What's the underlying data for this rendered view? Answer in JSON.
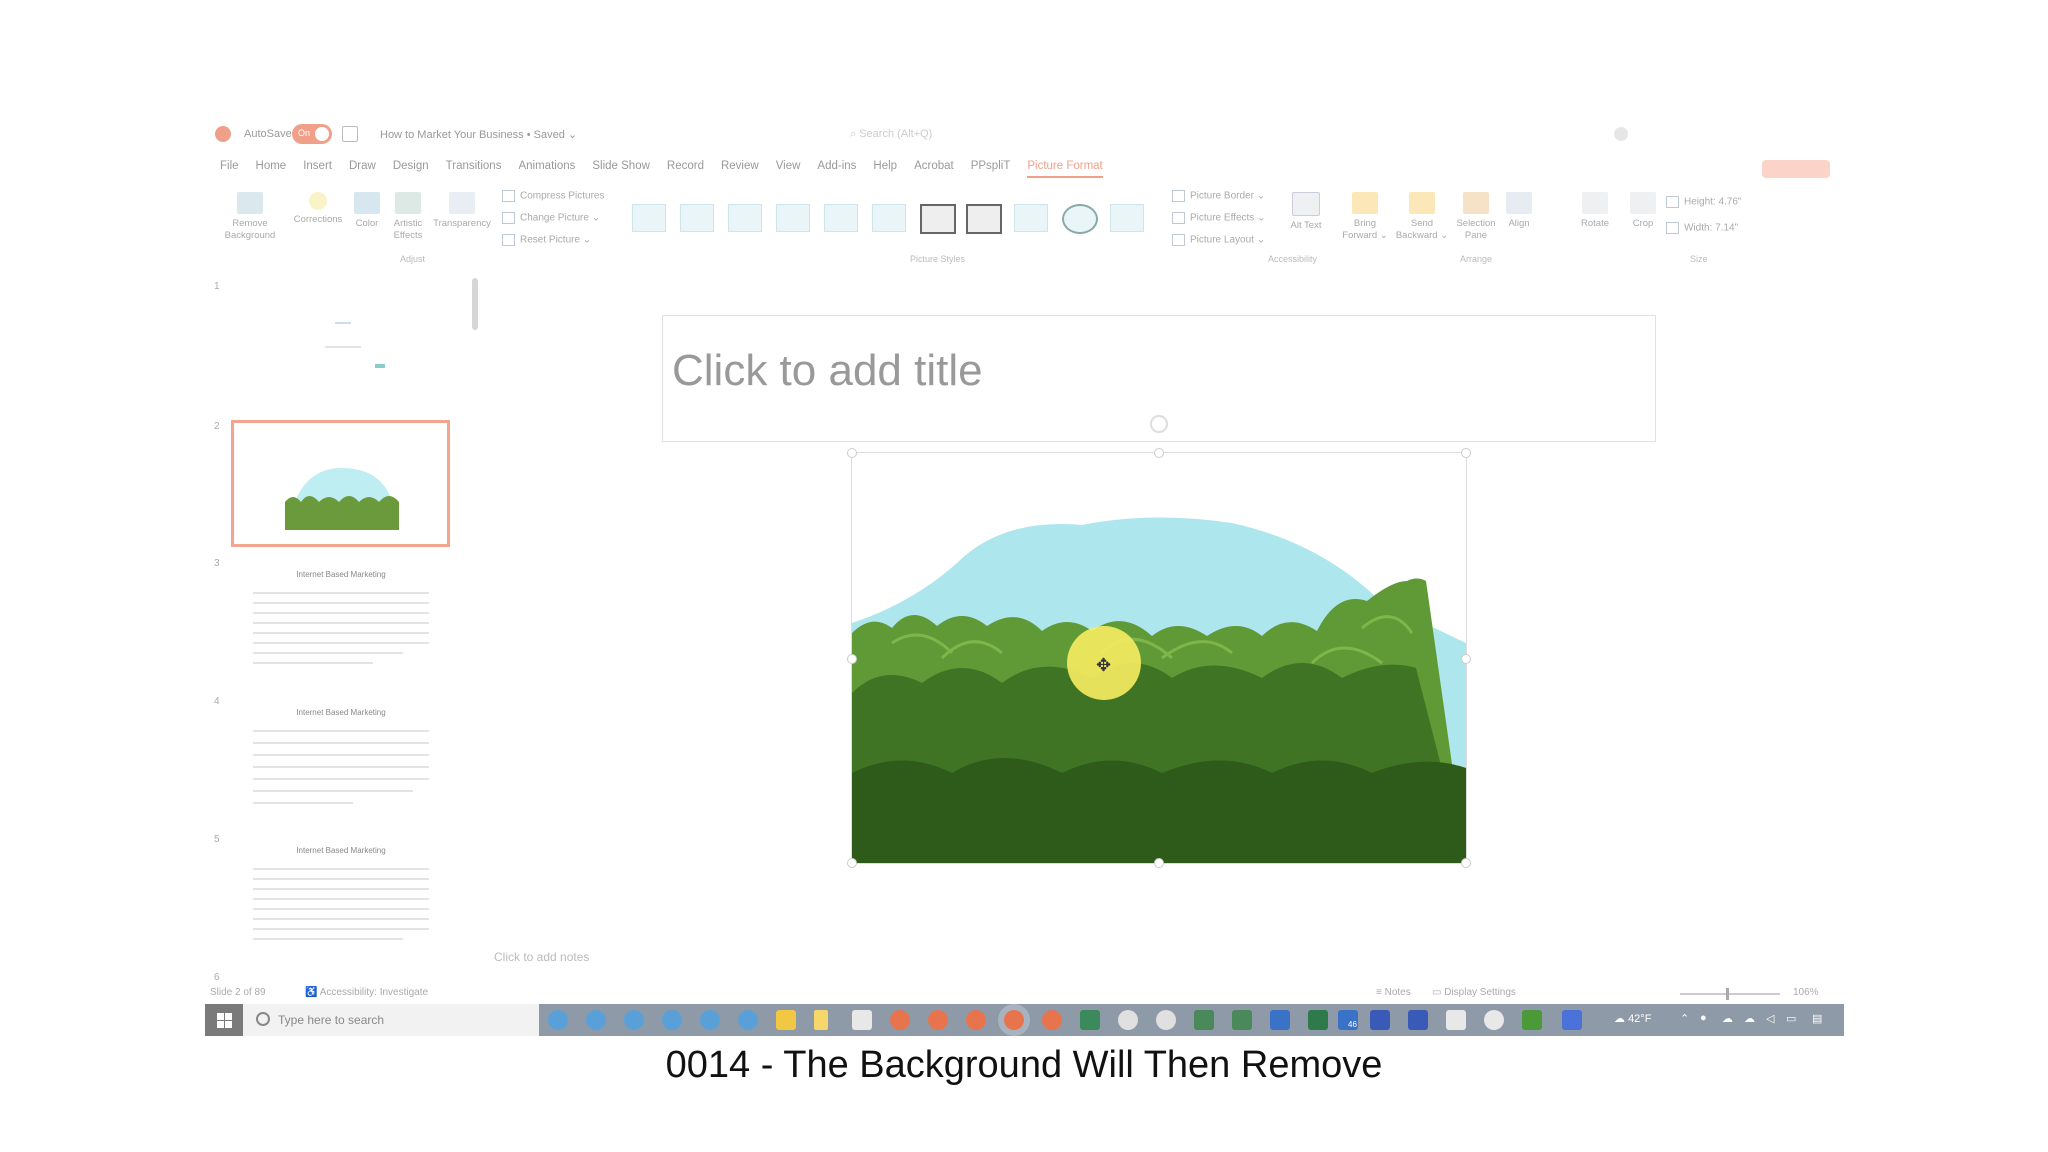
{
  "titlebar": {
    "autosave_label": "AutoSave",
    "autosave_state": "On",
    "document_title": "How to Market Your Business • Saved ⌄",
    "search_placeholder": "Search (Alt+Q)"
  },
  "menu_tabs": [
    "File",
    "Home",
    "Insert",
    "Draw",
    "Design",
    "Transitions",
    "Animations",
    "Slide Show",
    "Record",
    "Review",
    "View",
    "Add-ins",
    "Help",
    "Acrobat",
    "PPspliT",
    "Picture Format"
  ],
  "active_tab": "Picture Format",
  "ribbon": {
    "adjust": {
      "remove_background": "Remove Background",
      "corrections": "Corrections",
      "color": "Color",
      "artistic_effects": "Artistic Effects",
      "transparency": "Transparency",
      "compress": "Compress Pictures",
      "change": "Change Picture ⌄",
      "reset": "Reset Picture ⌄",
      "group_label": "Adjust"
    },
    "styles_group_label": "Picture Styles",
    "picture_border": "Picture Border ⌄",
    "picture_effects": "Picture Effects ⌄",
    "picture_layout": "Picture Layout ⌄",
    "alt_text": "Alt Text",
    "accessibility_label": "Accessibility",
    "bring_forward": "Bring Forward ⌄",
    "send_backward": "Send Backward ⌄",
    "selection_pane": "Selection Pane",
    "align": "Align",
    "rotate": "Rotate",
    "arrange_label": "Arrange",
    "crop": "Crop",
    "height_label": "Height:",
    "height_value": "4.76\"",
    "width_label": "Width:",
    "width_value": "7.14\"",
    "size_label": "Size"
  },
  "slides": [
    {
      "num": "1",
      "title": ""
    },
    {
      "num": "2",
      "title": ""
    },
    {
      "num": "3",
      "title": "Internet Based Marketing"
    },
    {
      "num": "4",
      "title": "Internet Based Marketing"
    },
    {
      "num": "5",
      "title": "Internet Based Marketing"
    },
    {
      "num": "6",
      "title": ""
    }
  ],
  "slide": {
    "title_placeholder": "Click to add title",
    "notes_placeholder": "Click to add notes"
  },
  "statusbar": {
    "slide_info": "Slide 2 of 89",
    "accessibility": "Accessibility: Investigate",
    "notes": "Notes",
    "display_settings": "Display Settings",
    "zoom": "106%",
    "zoom_fraction": 0.46
  },
  "taskbar": {
    "search_placeholder": "Type here to search",
    "weather": "42°F",
    "badge": "46"
  },
  "caption": "0014 - The Background Will Then Remove",
  "colors": {
    "accent": "#f0a08a",
    "taskbar": "#8f9aa8",
    "sky": "#aee6ee",
    "highlight": "#f7ed62"
  }
}
